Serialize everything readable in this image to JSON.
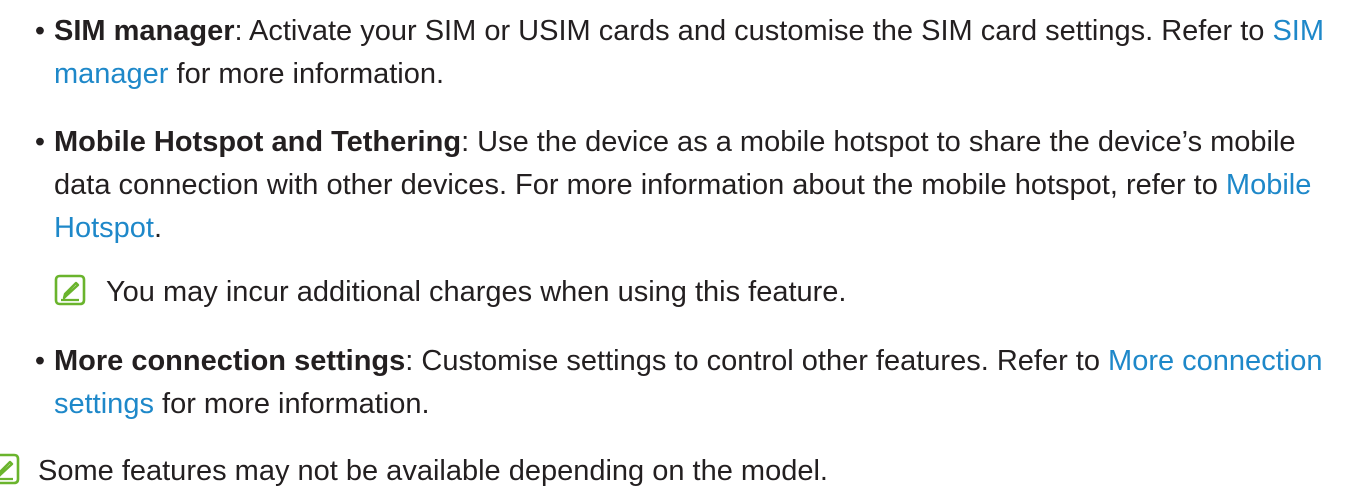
{
  "items": [
    {
      "bullet": "•",
      "term": "SIM manager",
      "text_before": ": Activate your SIM or USIM cards and customise the SIM card settings. Refer to ",
      "link": "SIM manager",
      "text_after": " for more information."
    },
    {
      "bullet": "•",
      "term": "Mobile Hotspot and Tethering",
      "text_before": ": Use the device as a mobile hotspot to share the device’s mobile data connection with other devices. For more information about the mobile hotspot, refer to ",
      "link": "Mobile Hotspot",
      "text_after": "."
    },
    {
      "bullet": "•",
      "term": "More connection settings",
      "text_before": ": Customise settings to control other features. Refer to ",
      "link": "More connection settings",
      "text_after": " for more information."
    }
  ],
  "notes": [
    {
      "icon": "note-pen-icon",
      "text": "You may incur additional charges when using this feature."
    },
    {
      "icon": "note-pen-icon",
      "text": "Some features may not be available depending on the model."
    }
  ],
  "colors": {
    "text": "#231f20",
    "link": "#1e88c9",
    "icon": "#6ab42d"
  }
}
